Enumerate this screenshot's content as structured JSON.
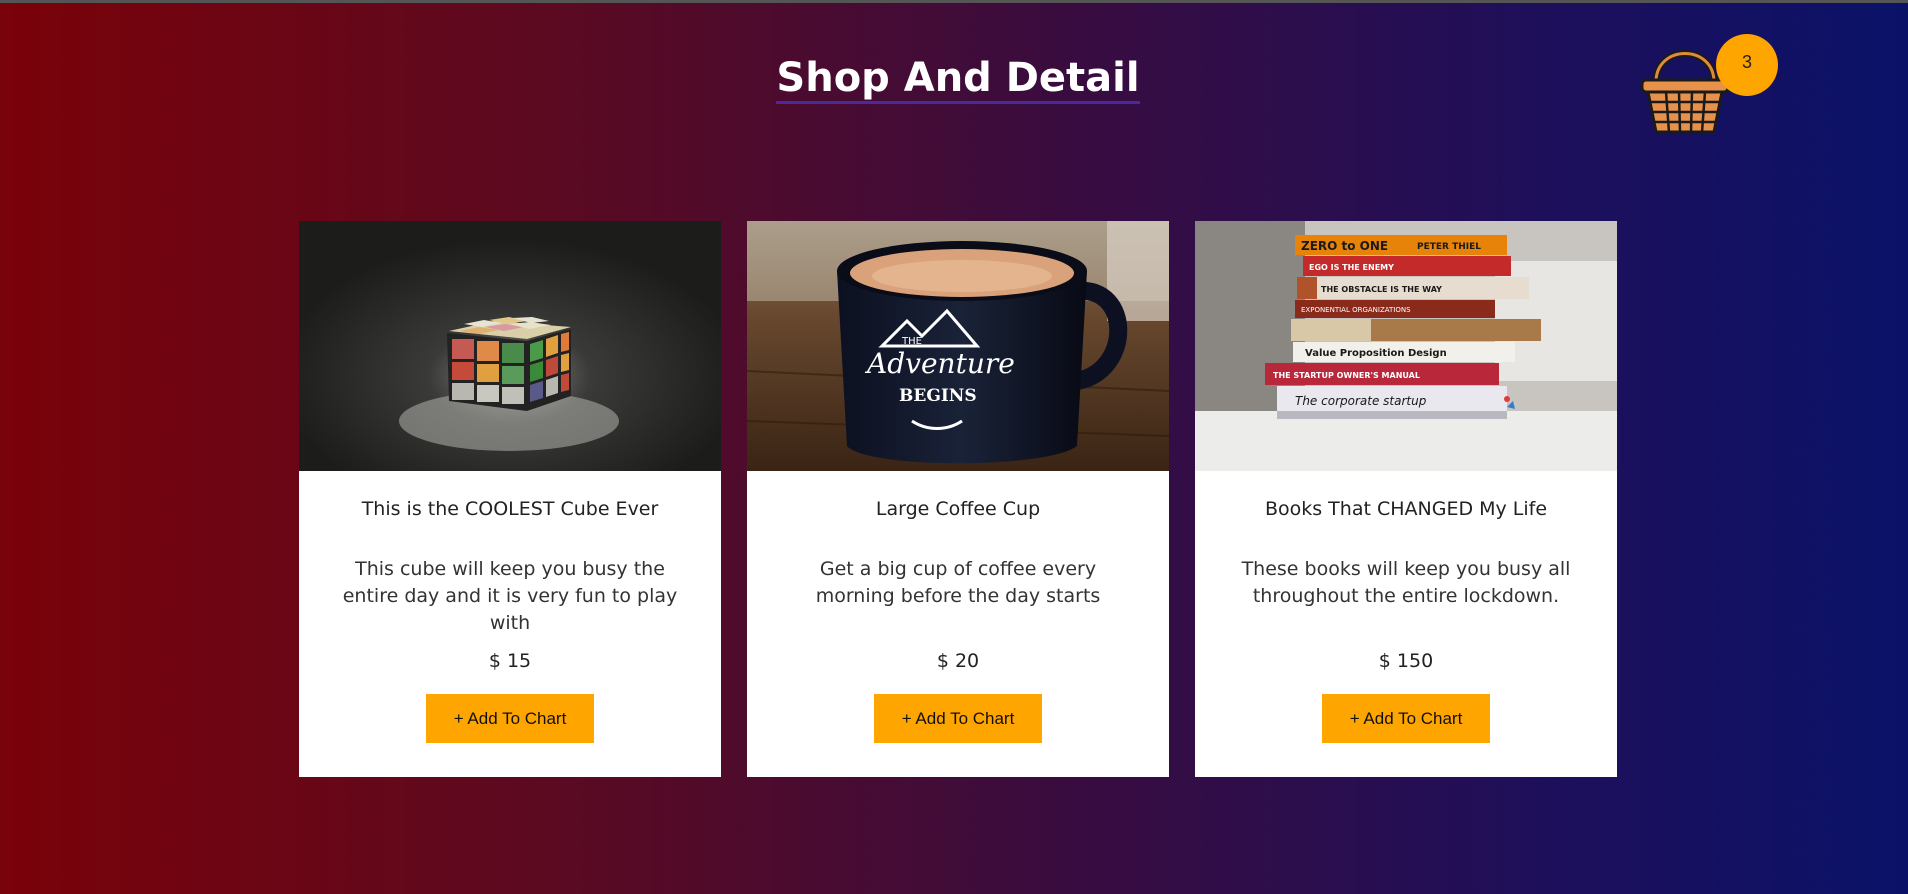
{
  "header": {
    "title": "Shop And Detail",
    "cart_count": "3"
  },
  "colors": {
    "accent": "#ffa500",
    "gradient_left": "#7a0209",
    "gradient_right": "#0a1268"
  },
  "products": [
    {
      "title": "This is the COOLEST Cube Ever",
      "description": "This cube will keep you busy the entire day and it is very fun to play with",
      "price": "$ 15",
      "button_label": "+ Add To Chart",
      "image": "rubiks-cube-photo"
    },
    {
      "title": "Large Coffee Cup",
      "description": "Get a big cup of coffee every morning before the day starts",
      "price": "$ 20",
      "button_label": "+ Add To Chart",
      "image": "coffee-mug-photo"
    },
    {
      "title": "Books That CHANGED My Life",
      "description": "These books will keep you busy all throughout the entire lockdown.",
      "price": "$ 150",
      "button_label": "+ Add To Chart",
      "image": "book-stack-photo",
      "image_text": {
        "book1": "ZERO to ONE",
        "book1_author": "PETER THIEL",
        "book2": "EGO IS THE ENEMY",
        "book3": "THE OBSTACLE IS THE WAY",
        "book4": "EXPONENTIAL ORGANIZATIONS",
        "book5": "Value Proposition Design",
        "book6": "THE STARTUP OWNER'S MANUAL",
        "book7": "The corporate startup"
      }
    }
  ]
}
